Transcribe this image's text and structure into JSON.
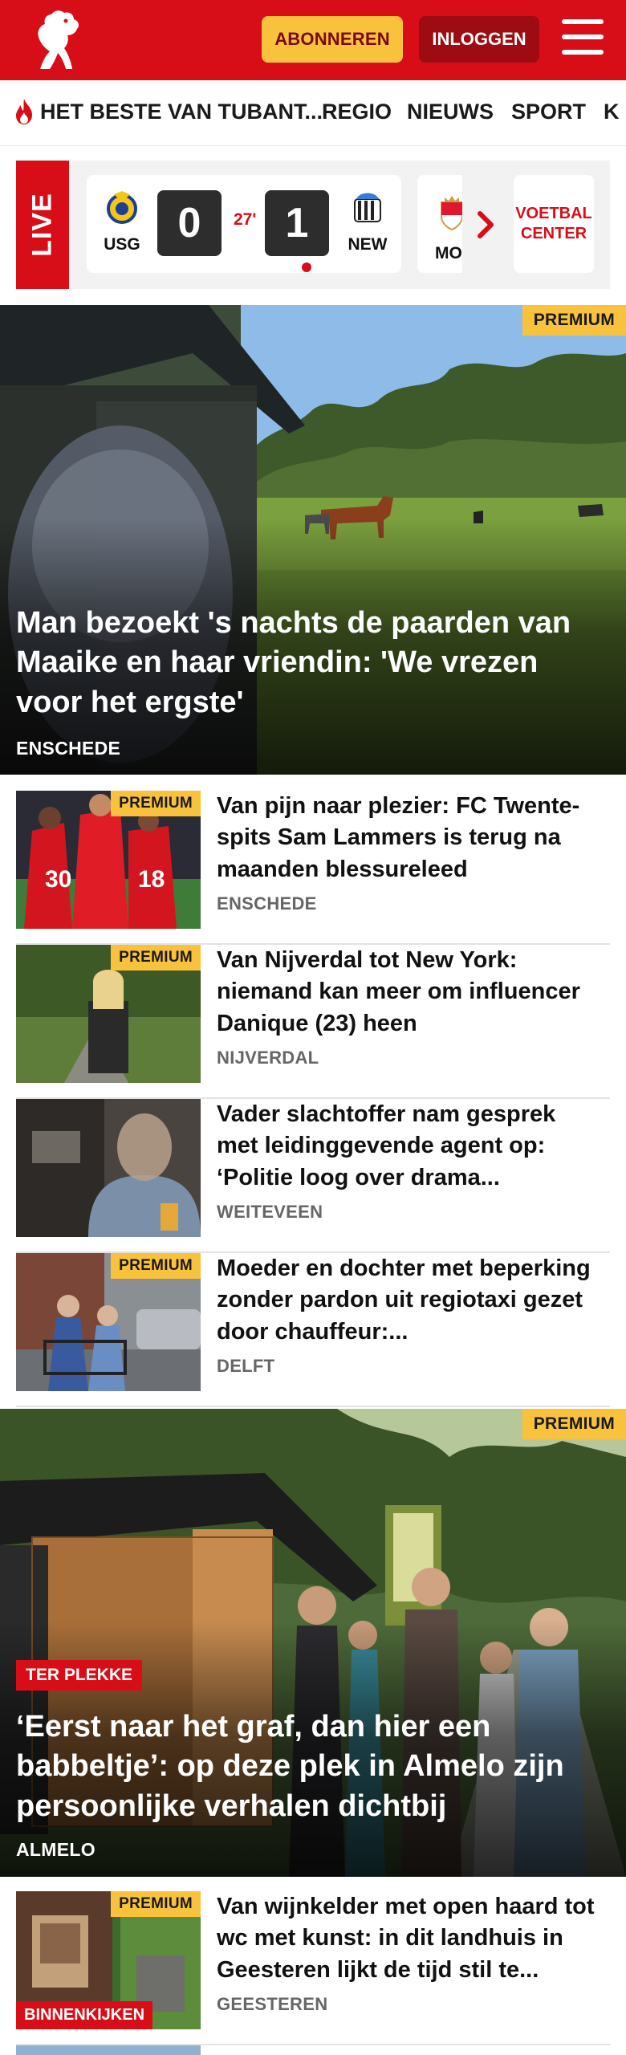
{
  "header": {
    "subscribe_label": "ABONNEREN",
    "login_label": "INLOGGEN",
    "brand_color": "#d70e17",
    "subscribe_color": "#f9c23c"
  },
  "nav": {
    "items": [
      {
        "label": "HET BESTE VAN TUBANT..."
      },
      {
        "label": "REGIO"
      },
      {
        "label": "NIEUWS"
      },
      {
        "label": "SPORT"
      },
      {
        "label": "K"
      }
    ]
  },
  "live": {
    "tag": "LIVE",
    "match": {
      "home_code": "USG",
      "home_score": "0",
      "minute": "27'",
      "away_score": "1",
      "away_code": "NEW"
    },
    "next_match": {
      "home_code": "MO"
    },
    "voetbalcenter_line1": "VOETBAL",
    "voetbalcenter_line2": "CENTER"
  },
  "hero1": {
    "badge": "PREMIUM",
    "title": "Man bezoekt 's nachts de paarden van Maaike en haar vriendin: 'We vrezen voor het ergste'",
    "place": "ENSCHEDE"
  },
  "list1": [
    {
      "badge": "PREMIUM",
      "title": "Van pijn naar plezier: FC Twente-spits Sam Lammers is terug na maanden blessureleed",
      "place": "ENSCHEDE"
    },
    {
      "badge": "PREMIUM",
      "title": "Van Nijverdal tot New York: niemand kan meer om influencer Danique (23) heen",
      "place": "NIJVERDAL"
    },
    {
      "badge": "",
      "title": "Vader slachtoffer nam gesprek met leidinggevende agent op: ‘Politie loog over drama...",
      "place": "WEITEVEEN"
    },
    {
      "badge": "PREMIUM",
      "title": "Moeder en dochter met beperking zonder pardon uit regiotaxi gezet door chauffeur:...",
      "place": "DELFT"
    }
  ],
  "hero2": {
    "badge": "PREMIUM",
    "label": "TER PLEKKE",
    "title": "‘Eerst naar het graf, dan hier een babbeltje’: op deze plek in Almelo zijn persoonlijke verhalen dichtbij",
    "place": "ALMELO"
  },
  "list2": [
    {
      "badge": "PREMIUM",
      "label": "BINNENKIJKEN",
      "title": "Van wijnkelder met open haard tot wc met kunst: in dit landhuis in Geesteren lijkt de tijd stil te...",
      "place": "GEESTEREN"
    }
  ],
  "icons": {
    "logo": "tubantia-horse-logo",
    "menu": "hamburger-menu-icon",
    "trending": "flame-icon",
    "next": "chevron-right-icon"
  }
}
